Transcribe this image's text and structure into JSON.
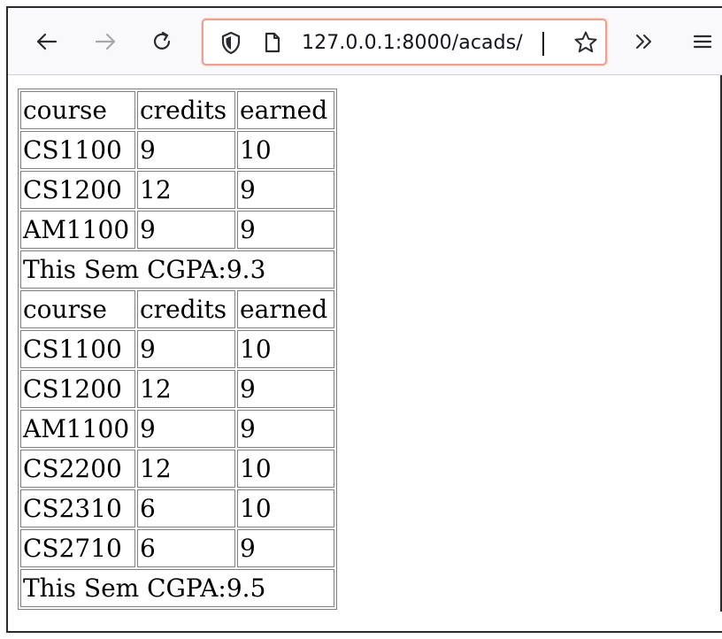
{
  "browser": {
    "url": "127.0.0.1:8000/acads/",
    "icons": [
      "back-arrow-icon",
      "forward-arrow-icon",
      "reload-icon",
      "shield-icon",
      "page-icon",
      "star-icon",
      "overflow-chevron-icon",
      "hamburger-menu-icon"
    ]
  },
  "table": {
    "header": {
      "course": "course",
      "credits": "credits",
      "earned": "earned"
    },
    "sem1": {
      "rows": [
        {
          "course": "CS1100",
          "credits": "9",
          "earned": "10"
        },
        {
          "course": "CS1200",
          "credits": "12",
          "earned": "9"
        },
        {
          "course": "AM1100",
          "credits": "9",
          "earned": "9"
        }
      ],
      "cgpa": "This Sem CGPA:9.3"
    },
    "sem2": {
      "rows": [
        {
          "course": "CS1100",
          "credits": "9",
          "earned": "10"
        },
        {
          "course": "CS1200",
          "credits": "12",
          "earned": "9"
        },
        {
          "course": "AM1100",
          "credits": "9",
          "earned": "9"
        },
        {
          "course": "CS2200",
          "credits": "12",
          "earned": "10"
        },
        {
          "course": "CS2310",
          "credits": "6",
          "earned": "10"
        },
        {
          "course": "CS2710",
          "credits": "6",
          "earned": "9"
        }
      ],
      "cgpa": "This Sem CGPA:9.5"
    }
  }
}
